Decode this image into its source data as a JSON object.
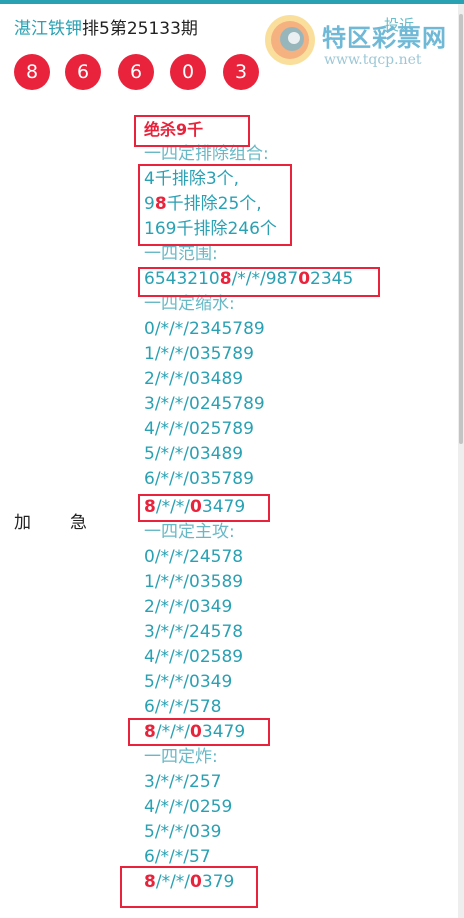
{
  "header": {
    "title_link": "湛江铁钾",
    "title_rest": "排5第25133期",
    "balls": [
      "8",
      "6",
      "6",
      "0",
      "3"
    ],
    "logo_text": "特区彩票网",
    "logo_url": "www.tqcp.net",
    "topright_text": "投近"
  },
  "side": {
    "label1": "加",
    "label2": "急"
  },
  "content": {
    "kill_title": "绝杀9千",
    "section1": "一四定排除组合:",
    "excl1": "4千排除3个,",
    "excl2_a": "9",
    "excl2_b": "8",
    "excl2_c": "千排除25个,",
    "excl3": "169千排除246个",
    "section2": "一四范围:",
    "range_a": "6543210",
    "range_b": "8",
    "range_c": "/*/*/987",
    "range_d": "0",
    "range_e": "2345",
    "section3": "一四定缩水:",
    "shrink": [
      "0/*/*/2345789",
      "1/*/*/035789",
      "2/*/*/03489",
      "3/*/*/0245789",
      "4/*/*/025789",
      "5/*/*/03489",
      "6/*/*/035789"
    ],
    "shrink_last": {
      "a": "8",
      "b": "/*/*/",
      "c": "0",
      "d": "3479"
    },
    "section4": "一四定主攻:",
    "attack": [
      "0/*/*/24578",
      "1/*/*/03589",
      "2/*/*/0349",
      "3/*/*/24578",
      "4/*/*/02589",
      "5/*/*/0349",
      "6/*/*/578"
    ],
    "attack_last": {
      "a": "8",
      "b": "/*/*/",
      "c": "0",
      "d": "3479"
    },
    "section5": "一四定炸:",
    "bomb": [
      "3/*/*/257",
      "4/*/*/0259",
      "5/*/*/039",
      "6/*/*/57"
    ],
    "bomb_last": {
      "a": "8",
      "b": "/*/*/",
      "c": "0",
      "d": "379"
    }
  },
  "colors": {
    "accent": "#2aa1b3",
    "red": "#e8233b"
  }
}
